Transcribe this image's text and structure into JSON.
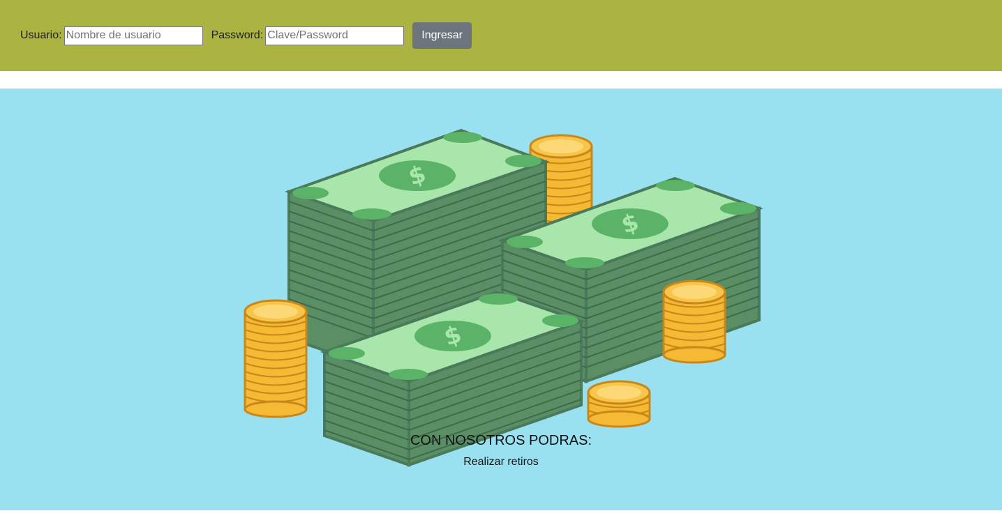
{
  "header": {
    "user_label": "Usuario:",
    "user_placeholder": "Nombre de usuario",
    "user_value": "",
    "password_label": "Password:",
    "password_placeholder": "Clave/Password",
    "password_value": "",
    "submit_label": "Ingresar"
  },
  "hero": {
    "illustration": "money-stacks-and-coins-icon",
    "title": "CON NOSOTROS PODRAS:",
    "item": "Realizar retiros"
  },
  "colors": {
    "header_bg": "#abb341",
    "hero_bg": "#99e1f1",
    "button_bg": "#6c757d",
    "bill_light": "#a8e6ab",
    "bill_dark": "#4a7a5a",
    "coin": "#f5b933"
  }
}
